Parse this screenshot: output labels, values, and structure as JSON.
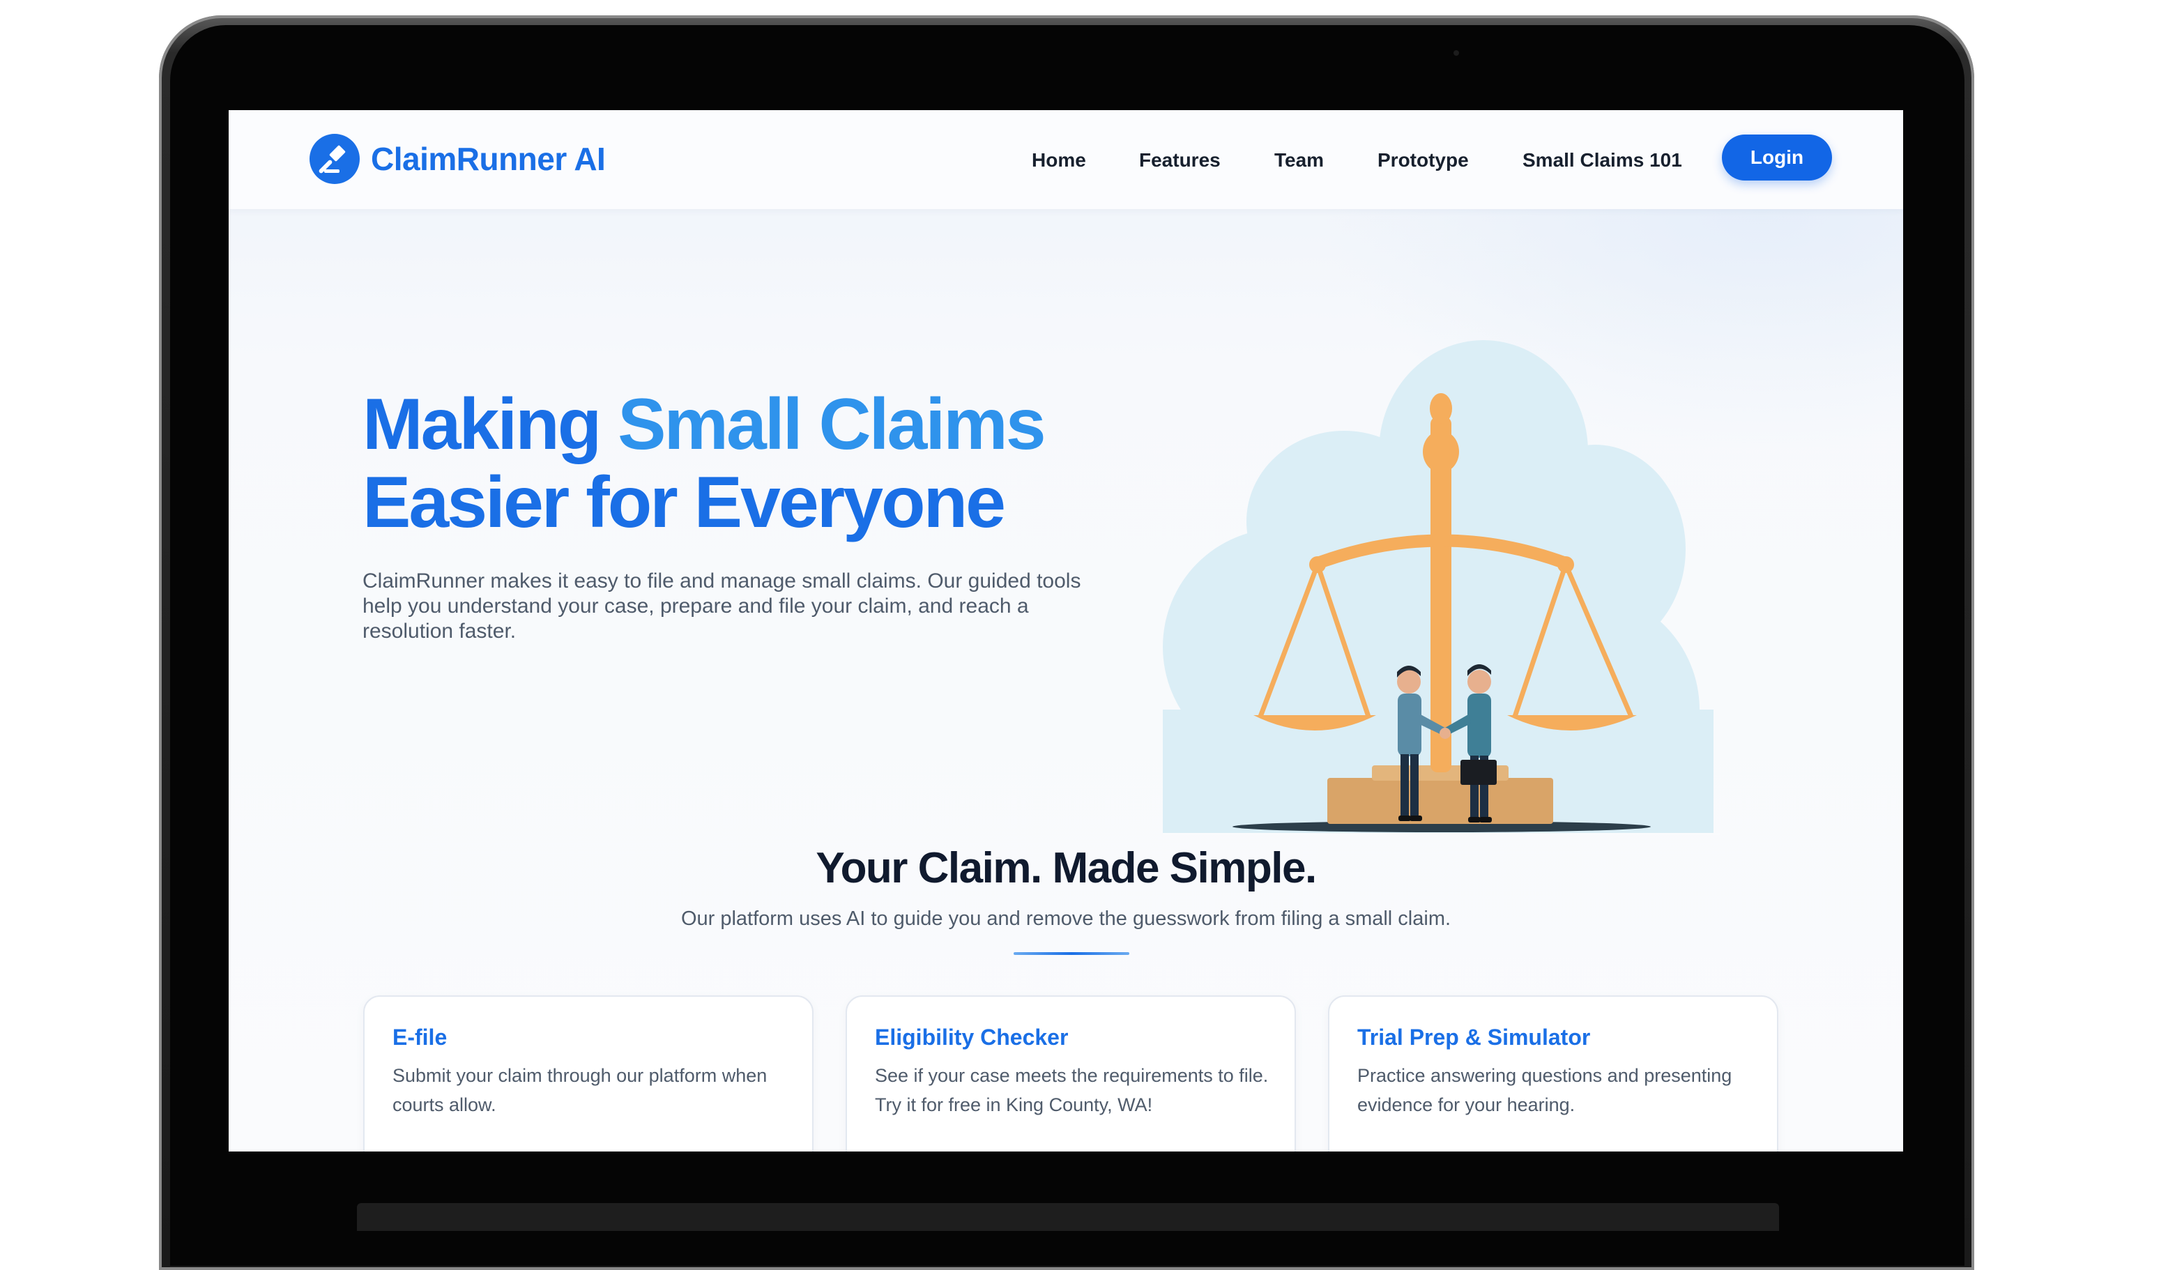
{
  "brand": {
    "name": "ClaimRunner AI"
  },
  "nav": {
    "links": [
      "Home",
      "Features",
      "Team",
      "Prototype",
      "Small Claims 101"
    ],
    "login_label": "Login"
  },
  "hero": {
    "title_part1": "Making ",
    "title_accent": "Small Claims",
    "title_line2": "Easier for Everyone",
    "description": "ClaimRunner makes it easy to file and manage small claims. Our guided tools help you understand your case, prepare and file your claim, and reach a resolution faster."
  },
  "features": {
    "title": "Your Claim. Made Simple.",
    "subtitle": "Our platform uses AI to guide you and remove the guesswork from filing a small claim.",
    "cards": [
      {
        "title": "E-file",
        "description": "Submit your claim through our platform when courts allow."
      },
      {
        "title": "Eligibility Checker",
        "description": "See if your case meets the requirements to file. Try it for free in King County, WA!"
      },
      {
        "title": "Trial Prep & Simulator",
        "description": "Practice answering questions and presenting evidence for your hearing."
      }
    ]
  },
  "colors": {
    "brand_blue": "#1a6fe6",
    "accent_blue": "#2f93ec",
    "scale_orange": "#f5ad5c",
    "cloud": "#dbeef6"
  },
  "icons": {
    "brand_logo": "gavel-icon",
    "illustration": "scales-of-justice-handshake"
  }
}
